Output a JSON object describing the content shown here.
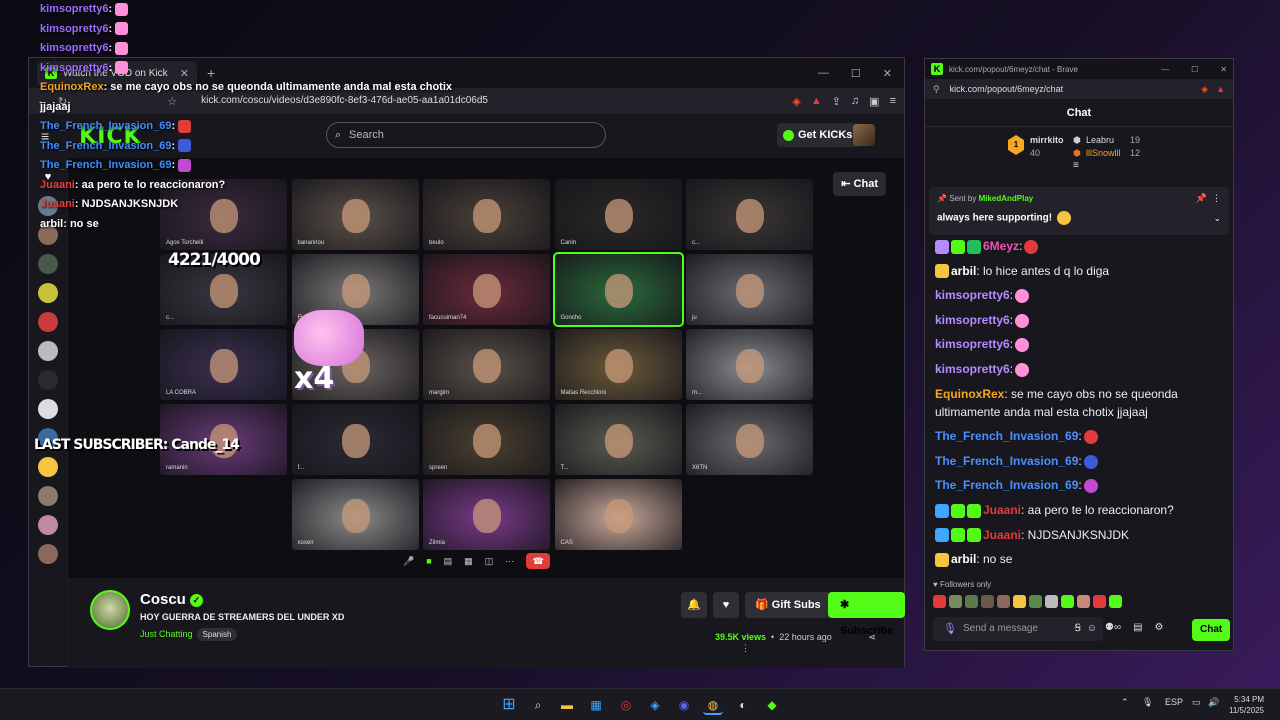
{
  "overlay_chat": [
    {
      "user": "kimsopretty6",
      "text": ":",
      "emote": "#ff8fd8",
      "color": "purple"
    },
    {
      "user": "kimsopretty6",
      "text": ":",
      "emote": "#ff8fd8",
      "color": "purple"
    },
    {
      "user": "kimsopretty6",
      "text": ":",
      "emote": "#ff8fd8",
      "color": "purple"
    },
    {
      "user": "kimsopretty6",
      "text": ":",
      "emote": "#ff8fd8",
      "color": "purple"
    },
    {
      "user": "EquinoxRex",
      "text": ": se me cayo obs no se queonda ultimamente anda mal esta chotix",
      "emote": "",
      "color": "orange"
    },
    {
      "user": "",
      "text": "jjajaaj",
      "emote": "",
      "color": "white"
    },
    {
      "user": "The_French_Invasion_69",
      "text": ":",
      "emote": "#e23b3b",
      "color": "blue"
    },
    {
      "user": "The_French_Invasion_69",
      "text": ":",
      "emote": "#3b5bdb",
      "color": "blue"
    },
    {
      "user": "The_French_Invasion_69",
      "text": ":",
      "emote": "#c04ad0",
      "color": "blue"
    },
    {
      "user": "Juaani",
      "text": ": aa pero te lo reaccionaron?",
      "emote": "",
      "color": "red"
    },
    {
      "user": "Juaani",
      "text": ": NJDSANJKSNJDK",
      "emote": "",
      "color": "red"
    },
    {
      "user": "arbil",
      "text": ": no se",
      "emote": "",
      "color": "white"
    }
  ],
  "browser": {
    "tab_title": "Watch the VOD on Kick",
    "url": "kick.com/coscu/videos/d3e890fc-8ef3-476d-ae05-aa1a01dc06d5",
    "search_placeholder": "Search",
    "get_kicks": "Get KICKs",
    "logo": "KICK"
  },
  "video": {
    "counter": "4221/4000",
    "multiplier": "x4",
    "last_subscriber": "LAST SUBSCRIBER: Cande_14",
    "chat_toggle": "Chat",
    "participants": [
      "Agos Torchelli",
      "bananirou",
      "beulo",
      "Canin",
      "c...",
      "c...",
      "Fl...",
      "facucuiman74",
      "Goncho",
      "ju",
      "LA COBRA",
      "",
      "margim",
      "Matias Recchioni",
      "m...",
      "ramanin",
      "f...",
      "spreen",
      "T...",
      "X6TN",
      "xoxen",
      "Zilmia",
      "CAS"
    ]
  },
  "stream": {
    "streamer": "Coscu",
    "title": "HOY GUERRA DE STREAMERS DEL UNDER XD",
    "category": "Just Chatting",
    "language": "Spanish",
    "gift_subs": "Gift Subs",
    "subscribe": "Subscribe",
    "views": "39.5K views",
    "ago": "22 hours ago"
  },
  "popout": {
    "window_title": "kick.com/popout/6meyz/chat - Brave",
    "url": "kick.com/popout/6meyz/chat",
    "header": "Chat",
    "leaderboard": [
      {
        "name": "mirrkito",
        "count": "40"
      },
      {
        "name": "Leabru",
        "count": "19"
      },
      {
        "name": "lllSnowlll",
        "count": "12"
      }
    ],
    "rank": "1",
    "pinned_by_label": "Sent by",
    "pinned_by_user": "MikedAndPlay",
    "pinned_message": "always here supporting!",
    "messages": [
      {
        "user": "6Meyz",
        "text": ":",
        "color": "pink"
      },
      {
        "user": "arbil",
        "text": ": lo hice antes d q lo diga",
        "color": "white"
      },
      {
        "user": "kimsopretty6",
        "text": ":",
        "color": "purple"
      },
      {
        "user": "kimsopretty6",
        "text": ":",
        "color": "purple"
      },
      {
        "user": "kimsopretty6",
        "text": ":",
        "color": "purple"
      },
      {
        "user": "kimsopretty6",
        "text": ":",
        "color": "purple"
      },
      {
        "user": "EquinoxRex",
        "text": ": se me cayo obs no se queonda ultimamente anda mal esta chotix jjajaaj",
        "color": "orange"
      },
      {
        "user": "The_French_Invasion_69",
        "text": ":",
        "color": "blue"
      },
      {
        "user": "The_French_Invasion_69",
        "text": ":",
        "color": "blue"
      },
      {
        "user": "The_French_Invasion_69",
        "text": ":",
        "color": "blue"
      },
      {
        "user": "Juaani",
        "text": ": aa pero te lo reaccionaron?",
        "color": "red"
      },
      {
        "user": "Juaani",
        "text": ": NJDSANJKSNJDK",
        "color": "red"
      },
      {
        "user": "arbil",
        "text": ": no se",
        "color": "white"
      }
    ],
    "followers_only": "Followers only",
    "send_placeholder": "Send a message",
    "chat_button": "Chat"
  },
  "taskbar": {
    "language": "ESP",
    "time": "5:34 PM",
    "date": "11/5/2025"
  },
  "colors": {
    "kick_green": "#53fc18",
    "background": "#18171d"
  }
}
